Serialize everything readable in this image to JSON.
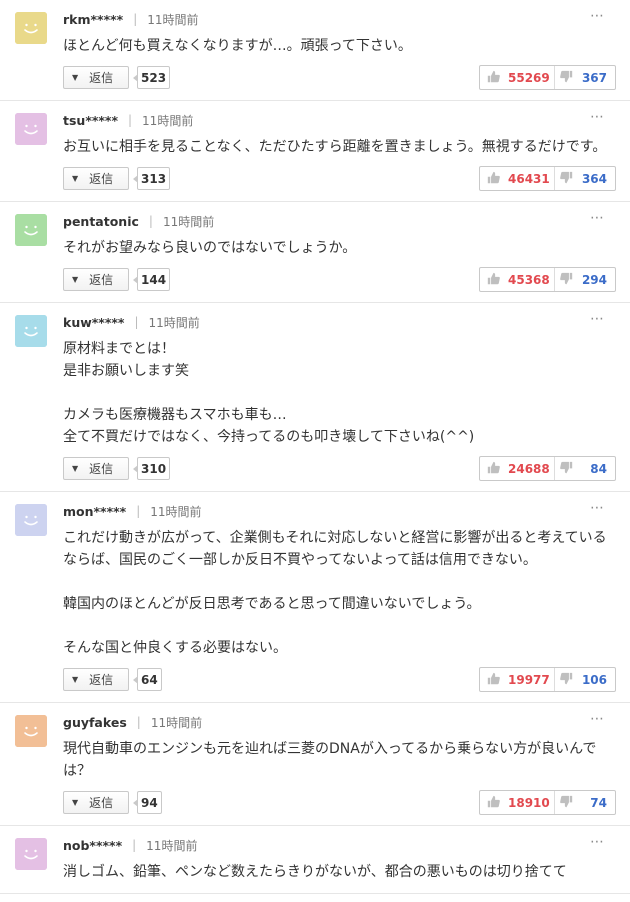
{
  "reply_label": "返信",
  "more_icon": "⋯",
  "comments": [
    {
      "user": "rkm*****",
      "time": "11時間前",
      "text": "ほとんど何も買えなくなりますが…。頑張って下さい。",
      "replies": "523",
      "good": "55269",
      "bad": "367",
      "avatar_color": "#e9d98a"
    },
    {
      "user": "tsu*****",
      "time": "11時間前",
      "text": "お互いに相手を見ることなく、ただひたすら距離を置きましょう。無視するだけです。",
      "replies": "313",
      "good": "46431",
      "bad": "364",
      "avatar_color": "#e4c0e4"
    },
    {
      "user": "pentatonic",
      "time": "11時間前",
      "text": "それがお望みなら良いのではないでしょうか。",
      "replies": "144",
      "good": "45368",
      "bad": "294",
      "avatar_color": "#a9dea3"
    },
    {
      "user": "kuw*****",
      "time": "11時間前",
      "text": "原材料までとは！\n是非お願いします笑\n\nカメラも医療機器もスマホも車も…\n全て不買だけではなく、今持ってるのも叩き壊して下さいね(^^)",
      "replies": "310",
      "good": "24688",
      "bad": "84",
      "avatar_color": "#a7dcea"
    },
    {
      "user": "mon*****",
      "time": "11時間前",
      "text": "これだけ動きが広がって、企業側もそれに対応しないと経営に影響が出ると考えているならば、国民のごく一部しか反日不買やってないよって話は信用できない。\n\n韓国内のほとんどが反日思考であると思って間違いないでしょう。\n\nそんな国と仲良くする必要はない。",
      "replies": "64",
      "good": "19977",
      "bad": "106",
      "avatar_color": "#cdd3f0"
    },
    {
      "user": "guyfakes",
      "time": "11時間前",
      "text": "現代自動車のエンジンも元を辿れば三菱のDNAが入ってるから乗らない方が良いんでは？",
      "replies": "94",
      "good": "18910",
      "bad": "74",
      "avatar_color": "#f2bf96"
    },
    {
      "user": "nob*****",
      "time": "11時間前",
      "text": "消しゴム、鉛筆、ペンなど数えたらきりがないが、都合の悪いものは切り捨てて",
      "replies": "",
      "good": "",
      "bad": "",
      "avatar_color": "#e4c0e4"
    }
  ]
}
